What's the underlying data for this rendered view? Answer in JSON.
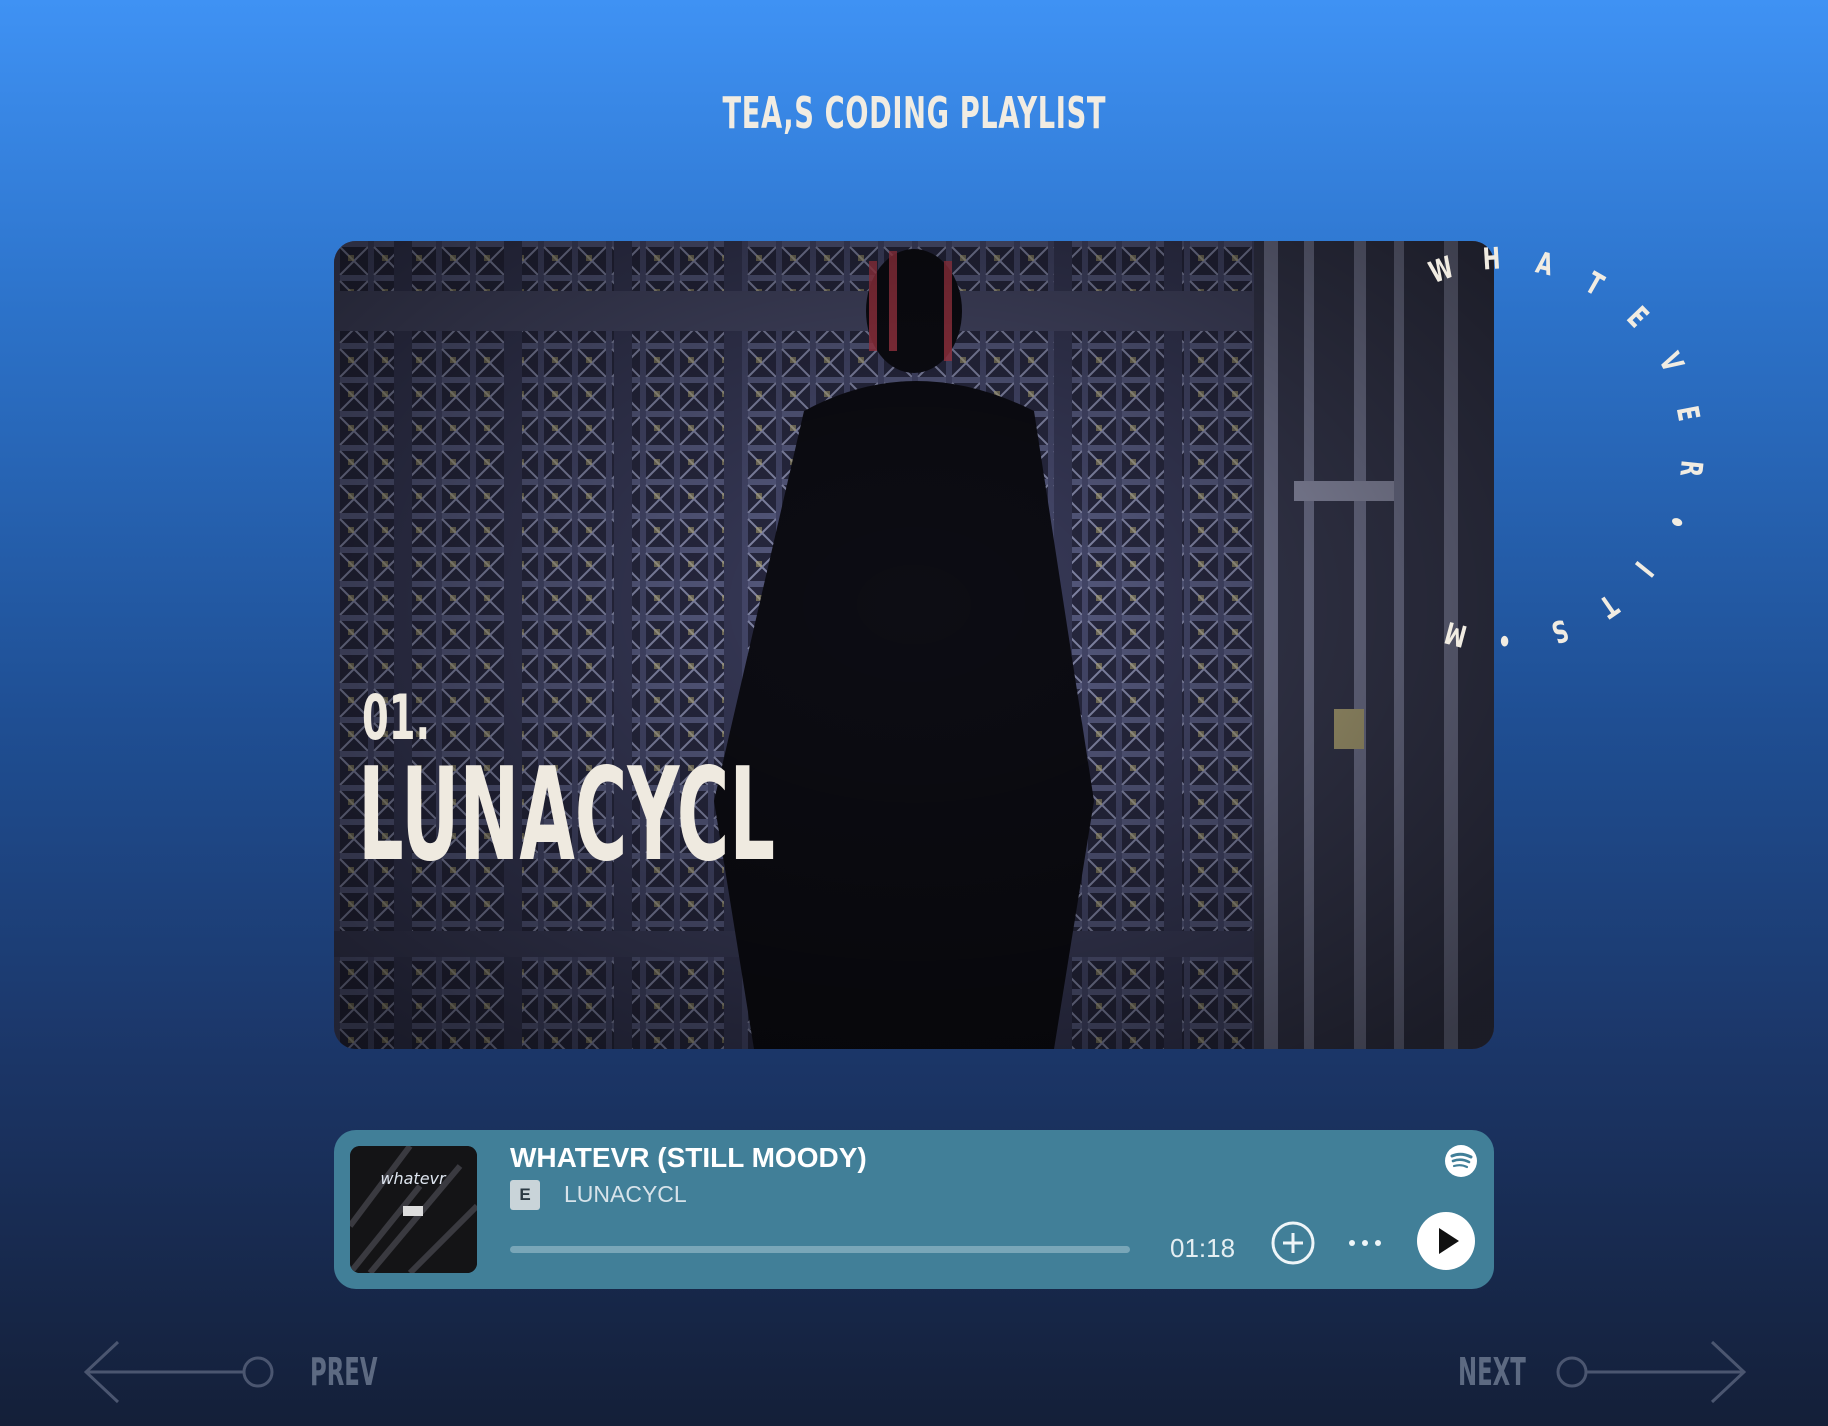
{
  "header": {
    "playlist_title": "TEA,S CODING PLAYLIST"
  },
  "hero": {
    "track_number": "01.",
    "artist": "LUNACYCL",
    "circular_text": [
      "W",
      "H",
      "A",
      "T",
      "E",
      "V",
      "E",
      "R",
      "•",
      "I",
      "T",
      "S",
      "•",
      "M"
    ]
  },
  "player": {
    "song_title": "WHATEVR (STILL MOODY)",
    "explicit_label": "E",
    "artist": "LUNACYCL",
    "time": "01:18",
    "progress": 0.0,
    "icons": [
      "spotify-icon",
      "add-circle-icon",
      "more-dots-icon",
      "play-icon"
    ],
    "accent_color": "#417f98"
  },
  "nav": {
    "prev_label": "PREV",
    "next_label": "NEXT",
    "icons": [
      "arrow-left-icon",
      "arrow-right-icon"
    ]
  }
}
